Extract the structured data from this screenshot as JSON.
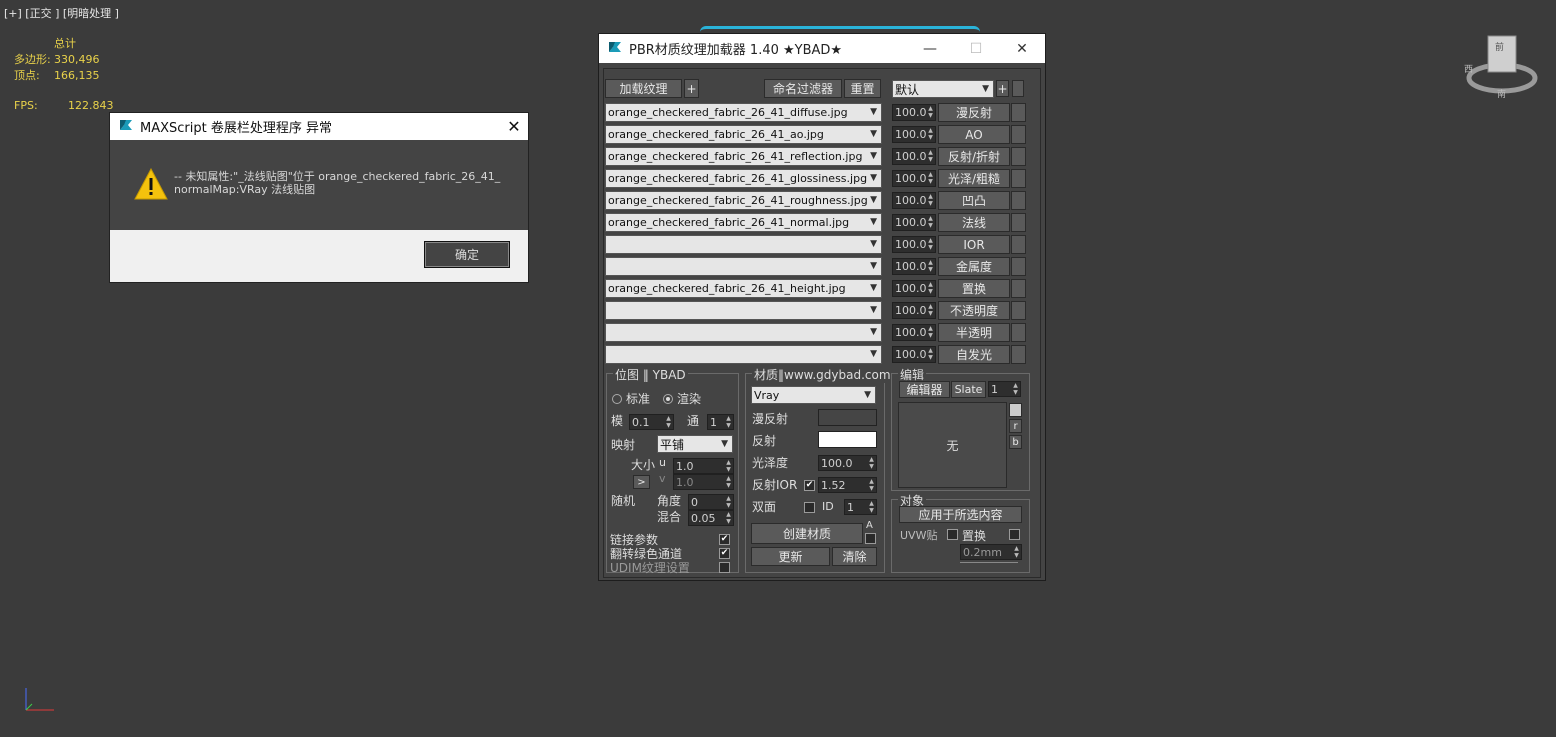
{
  "viewport": {
    "label": "[+] [正交 ] [明暗处理 ]",
    "stats_header": "总计",
    "polys_label": "多边形:",
    "polys_value": "330,496",
    "verts_label": "顶点:",
    "verts_value": "166,135",
    "fps_label": "FPS:",
    "fps_value": "122.843",
    "viewcube_top": "前",
    "viewcube_left": "西",
    "viewcube_bottom": "南"
  },
  "error_dialog": {
    "title": "MAXScript 卷展栏处理程序 异常",
    "message_line1": "-- 未知属性:\"_法线贴图\"位于 orange_checkered_fabric_26_41_",
    "message_line2": "normalMap:VRay 法线贴图",
    "ok_label": "确定"
  },
  "window": {
    "title": "PBR材质纹理加载器 1.40  ★YBAD★",
    "top_buttons": {
      "load": "加载纹理",
      "plus": "+",
      "name_filter": "命名过滤器",
      "reset": "重置",
      "preset": "默认",
      "preset_plus": "+"
    },
    "maps": [
      {
        "file": "orange_checkered_fabric_26_41_diffuse.jpg",
        "amount": "100.0",
        "label": "漫反射"
      },
      {
        "file": "orange_checkered_fabric_26_41_ao.jpg",
        "amount": "100.0",
        "label": "AO"
      },
      {
        "file": "orange_checkered_fabric_26_41_reflection.jpg",
        "amount": "100.0",
        "label": "反射/折射"
      },
      {
        "file": "orange_checkered_fabric_26_41_glossiness.jpg",
        "amount": "100.0",
        "label": "光泽/粗糙"
      },
      {
        "file": "orange_checkered_fabric_26_41_roughness.jpg",
        "amount": "100.0",
        "label": "凹凸"
      },
      {
        "file": "orange_checkered_fabric_26_41_normal.jpg",
        "amount": "100.0",
        "label": "法线"
      },
      {
        "file": "",
        "amount": "100.0",
        "label": "IOR"
      },
      {
        "file": "",
        "amount": "100.0",
        "label": "金属度"
      },
      {
        "file": "orange_checkered_fabric_26_41_height.jpg",
        "amount": "100.0",
        "label": "置换"
      },
      {
        "file": "",
        "amount": "100.0",
        "label": "不透明度"
      },
      {
        "file": "",
        "amount": "100.0",
        "label": "半透明"
      },
      {
        "file": "",
        "amount": "100.0",
        "label": "自发光"
      }
    ],
    "bitmap": {
      "title": "位图 ‖ YBAD",
      "standard": "标准",
      "render": "渲染",
      "blur_label": "模",
      "blur_value": "0.1",
      "channel_label": "通",
      "channel_value": "1",
      "mapping_label": "映射",
      "mapping_value": "平铺",
      "size_label": "大小",
      "u_label": "u",
      "u_value": "1.0",
      "v_label": "v",
      "v_value": "1.0",
      "more_btn": ">",
      "random_label": "随机",
      "angle_label": "角度",
      "angle_value": "0",
      "blend_label": "混合",
      "blend_value": "0.05",
      "link_params": "链接参数",
      "flip_green": "翻转绿色通道",
      "udim": "UDIM纹理设置"
    },
    "material": {
      "title": "材质‖www.gdybad.com",
      "renderer": "Vray",
      "diffuse_label": "漫反射",
      "reflect_label": "反射",
      "gloss_label": "光泽度",
      "gloss_value": "100.0",
      "ior_label": "反射IOR",
      "ior_value": "1.52",
      "twosided_label": "双面",
      "id_label": "ID",
      "id_value": "1",
      "create_btn": "创建材质",
      "a_btn": "A",
      "update_btn": "更新",
      "clear_btn": "清除"
    },
    "edit": {
      "title": "编辑",
      "editor_btn": "编辑器",
      "slate_btn": "Slate",
      "slot_value": "1",
      "preview_text": "无",
      "r_btn": "r",
      "b_btn": "b"
    },
    "object": {
      "title": "对象",
      "apply_btn": "应用于所选内容",
      "uvw_label": "UVW贴",
      "disp_label": "置换",
      "disp_value": "0.2mm"
    }
  }
}
